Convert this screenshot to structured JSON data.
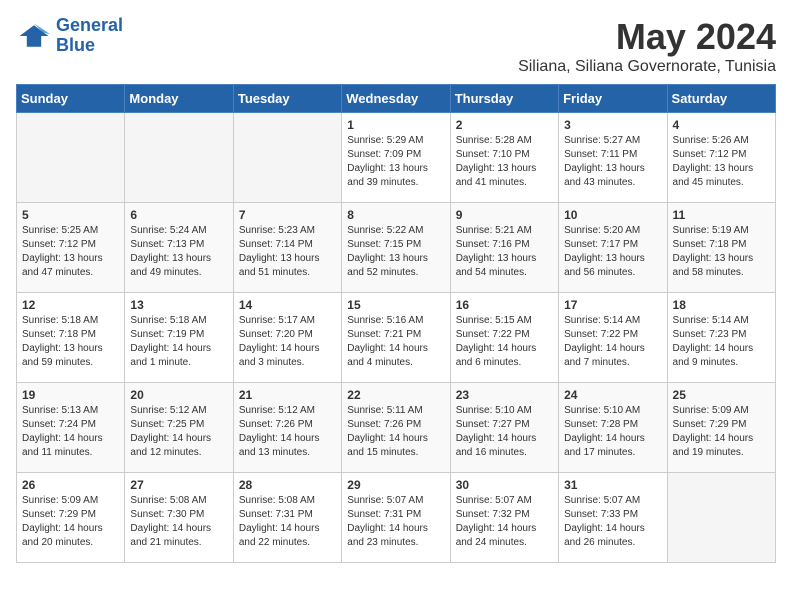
{
  "logo": {
    "line1": "General",
    "line2": "Blue"
  },
  "title": "May 2024",
  "subtitle": "Siliana, Siliana Governorate, Tunisia",
  "days_of_week": [
    "Sunday",
    "Monday",
    "Tuesday",
    "Wednesday",
    "Thursday",
    "Friday",
    "Saturday"
  ],
  "weeks": [
    [
      {
        "day": "",
        "info": ""
      },
      {
        "day": "",
        "info": ""
      },
      {
        "day": "",
        "info": ""
      },
      {
        "day": "1",
        "info": "Sunrise: 5:29 AM\nSunset: 7:09 PM\nDaylight: 13 hours\nand 39 minutes."
      },
      {
        "day": "2",
        "info": "Sunrise: 5:28 AM\nSunset: 7:10 PM\nDaylight: 13 hours\nand 41 minutes."
      },
      {
        "day": "3",
        "info": "Sunrise: 5:27 AM\nSunset: 7:11 PM\nDaylight: 13 hours\nand 43 minutes."
      },
      {
        "day": "4",
        "info": "Sunrise: 5:26 AM\nSunset: 7:12 PM\nDaylight: 13 hours\nand 45 minutes."
      }
    ],
    [
      {
        "day": "5",
        "info": "Sunrise: 5:25 AM\nSunset: 7:12 PM\nDaylight: 13 hours\nand 47 minutes."
      },
      {
        "day": "6",
        "info": "Sunrise: 5:24 AM\nSunset: 7:13 PM\nDaylight: 13 hours\nand 49 minutes."
      },
      {
        "day": "7",
        "info": "Sunrise: 5:23 AM\nSunset: 7:14 PM\nDaylight: 13 hours\nand 51 minutes."
      },
      {
        "day": "8",
        "info": "Sunrise: 5:22 AM\nSunset: 7:15 PM\nDaylight: 13 hours\nand 52 minutes."
      },
      {
        "day": "9",
        "info": "Sunrise: 5:21 AM\nSunset: 7:16 PM\nDaylight: 13 hours\nand 54 minutes."
      },
      {
        "day": "10",
        "info": "Sunrise: 5:20 AM\nSunset: 7:17 PM\nDaylight: 13 hours\nand 56 minutes."
      },
      {
        "day": "11",
        "info": "Sunrise: 5:19 AM\nSunset: 7:18 PM\nDaylight: 13 hours\nand 58 minutes."
      }
    ],
    [
      {
        "day": "12",
        "info": "Sunrise: 5:18 AM\nSunset: 7:18 PM\nDaylight: 13 hours\nand 59 minutes."
      },
      {
        "day": "13",
        "info": "Sunrise: 5:18 AM\nSunset: 7:19 PM\nDaylight: 14 hours\nand 1 minute."
      },
      {
        "day": "14",
        "info": "Sunrise: 5:17 AM\nSunset: 7:20 PM\nDaylight: 14 hours\nand 3 minutes."
      },
      {
        "day": "15",
        "info": "Sunrise: 5:16 AM\nSunset: 7:21 PM\nDaylight: 14 hours\nand 4 minutes."
      },
      {
        "day": "16",
        "info": "Sunrise: 5:15 AM\nSunset: 7:22 PM\nDaylight: 14 hours\nand 6 minutes."
      },
      {
        "day": "17",
        "info": "Sunrise: 5:14 AM\nSunset: 7:22 PM\nDaylight: 14 hours\nand 7 minutes."
      },
      {
        "day": "18",
        "info": "Sunrise: 5:14 AM\nSunset: 7:23 PM\nDaylight: 14 hours\nand 9 minutes."
      }
    ],
    [
      {
        "day": "19",
        "info": "Sunrise: 5:13 AM\nSunset: 7:24 PM\nDaylight: 14 hours\nand 11 minutes."
      },
      {
        "day": "20",
        "info": "Sunrise: 5:12 AM\nSunset: 7:25 PM\nDaylight: 14 hours\nand 12 minutes."
      },
      {
        "day": "21",
        "info": "Sunrise: 5:12 AM\nSunset: 7:26 PM\nDaylight: 14 hours\nand 13 minutes."
      },
      {
        "day": "22",
        "info": "Sunrise: 5:11 AM\nSunset: 7:26 PM\nDaylight: 14 hours\nand 15 minutes."
      },
      {
        "day": "23",
        "info": "Sunrise: 5:10 AM\nSunset: 7:27 PM\nDaylight: 14 hours\nand 16 minutes."
      },
      {
        "day": "24",
        "info": "Sunrise: 5:10 AM\nSunset: 7:28 PM\nDaylight: 14 hours\nand 17 minutes."
      },
      {
        "day": "25",
        "info": "Sunrise: 5:09 AM\nSunset: 7:29 PM\nDaylight: 14 hours\nand 19 minutes."
      }
    ],
    [
      {
        "day": "26",
        "info": "Sunrise: 5:09 AM\nSunset: 7:29 PM\nDaylight: 14 hours\nand 20 minutes."
      },
      {
        "day": "27",
        "info": "Sunrise: 5:08 AM\nSunset: 7:30 PM\nDaylight: 14 hours\nand 21 minutes."
      },
      {
        "day": "28",
        "info": "Sunrise: 5:08 AM\nSunset: 7:31 PM\nDaylight: 14 hours\nand 22 minutes."
      },
      {
        "day": "29",
        "info": "Sunrise: 5:07 AM\nSunset: 7:31 PM\nDaylight: 14 hours\nand 23 minutes."
      },
      {
        "day": "30",
        "info": "Sunrise: 5:07 AM\nSunset: 7:32 PM\nDaylight: 14 hours\nand 24 minutes."
      },
      {
        "day": "31",
        "info": "Sunrise: 5:07 AM\nSunset: 7:33 PM\nDaylight: 14 hours\nand 26 minutes."
      },
      {
        "day": "",
        "info": ""
      }
    ]
  ]
}
